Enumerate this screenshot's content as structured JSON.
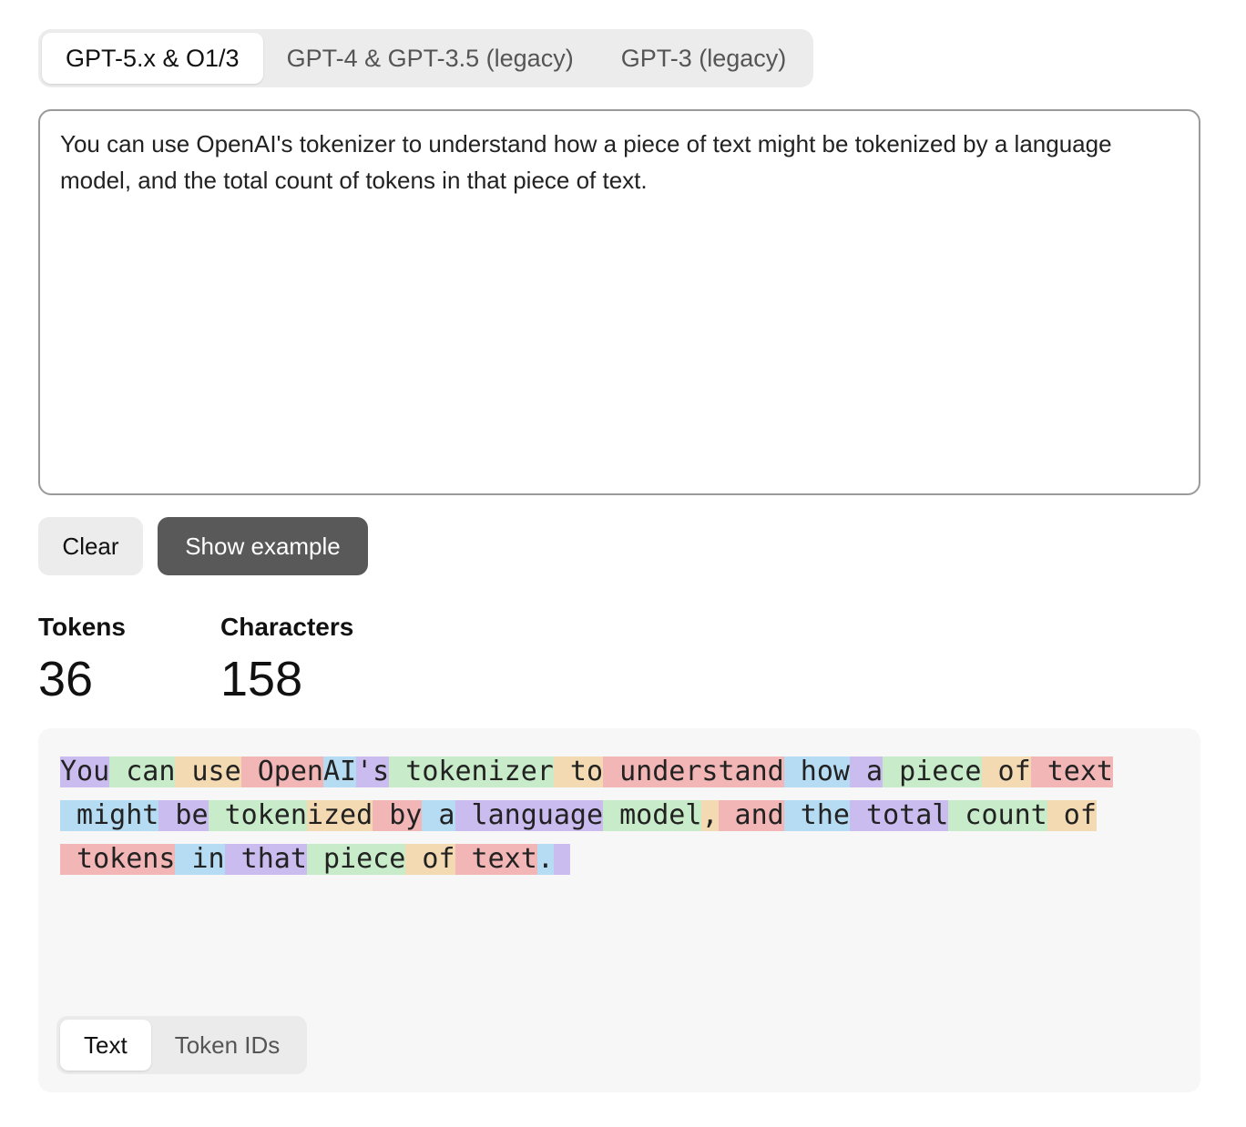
{
  "model_tabs": [
    {
      "label": "GPT-5.x & O1/3",
      "active": true
    },
    {
      "label": "GPT-4 & GPT-3.5 (legacy)",
      "active": false
    },
    {
      "label": "GPT-3 (legacy)",
      "active": false
    }
  ],
  "input": {
    "value": "You can use OpenAI's tokenizer to understand how a piece of text might be tokenized by a language model, and the total count of tokens in that piece of text."
  },
  "buttons": {
    "clear_label": "Clear",
    "example_label": "Show example"
  },
  "stats": {
    "tokens_label": "Tokens",
    "tokens_value": "36",
    "characters_label": "Characters",
    "characters_value": "158"
  },
  "colors": {
    "token_palette": [
      "#cbbcf0",
      "#c8ebc9",
      "#f4dab2",
      "#f2b6b6",
      "#b5dcf2"
    ],
    "primary_button": "#595959"
  },
  "tokens": [
    [
      "You",
      " can",
      " use",
      " Open",
      "AI",
      "'s",
      " tokenizer",
      " to",
      " understand",
      " how",
      " a",
      " piece",
      " of",
      " text"
    ],
    [
      " might",
      " be",
      " token",
      "ized",
      " by",
      " a",
      " language",
      " model",
      ",",
      " and",
      " the",
      " total",
      " count",
      " of"
    ],
    [
      " tokens",
      " in",
      " that",
      " piece",
      " of",
      " text",
      ".",
      " "
    ]
  ],
  "view_tabs": [
    {
      "label": "Text",
      "active": true
    },
    {
      "label": "Token IDs",
      "active": false
    }
  ]
}
